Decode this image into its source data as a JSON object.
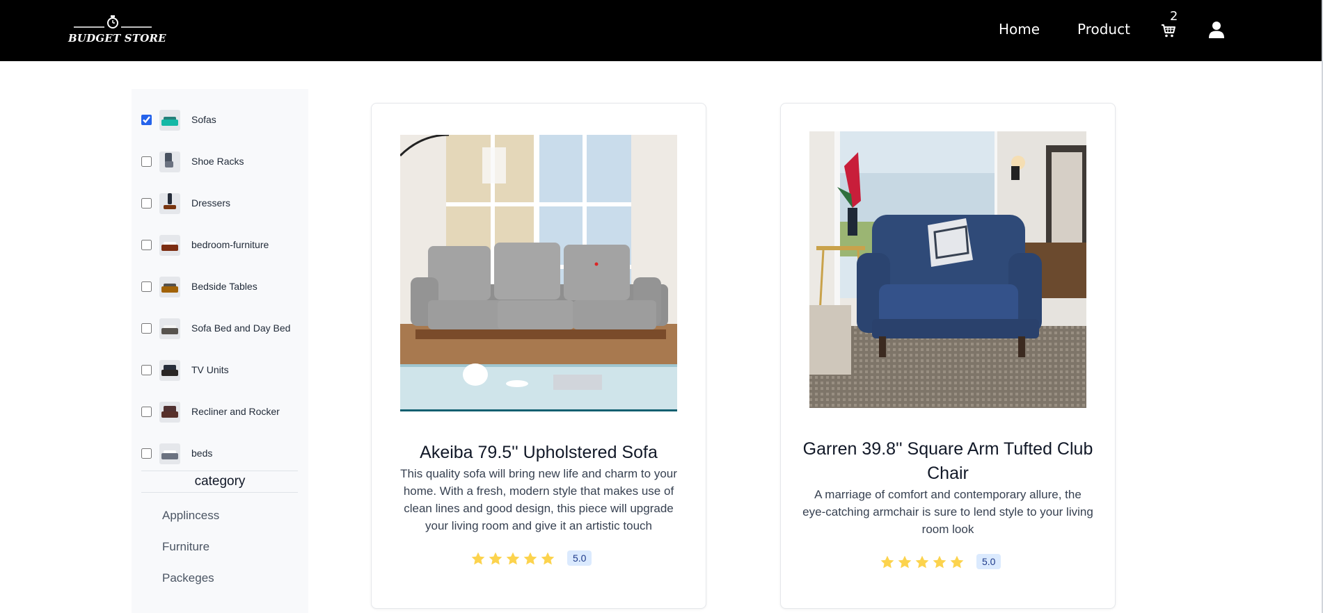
{
  "brand": {
    "name": "BUDGET STORE"
  },
  "nav": {
    "links": [
      {
        "label": "Home"
      },
      {
        "label": "Product"
      }
    ],
    "cart": {
      "count": "2",
      "icon": "shopping-cart-icon"
    },
    "user": {
      "icon": "user-icon"
    }
  },
  "sidebar": {
    "filters": [
      {
        "label": "Sofas",
        "checked": true
      },
      {
        "label": "Shoe Racks",
        "checked": false
      },
      {
        "label": "Dressers",
        "checked": false
      },
      {
        "label": "bedroom-furniture",
        "checked": false
      },
      {
        "label": "Bedside Tables",
        "checked": false
      },
      {
        "label": "Sofa Bed and Day Bed",
        "checked": false
      },
      {
        "label": "TV Units",
        "checked": false
      },
      {
        "label": "Recliner and Rocker",
        "checked": false
      },
      {
        "label": "beds",
        "checked": false
      }
    ],
    "category_title": "category",
    "categories": [
      {
        "label": "Applincess"
      },
      {
        "label": "Furniture"
      },
      {
        "label": "Packeges"
      }
    ]
  },
  "products": [
    {
      "title": "Akeiba 79.5'' Upholstered Sofa",
      "description": "This quality sofa will bring new life and charm to your home. With a fresh, modern style that makes use of clean lines and good design, this piece will upgrade your living room and give it an artistic touch",
      "rating": "5.0",
      "stars": 5
    },
    {
      "title": "Garren 39.8'' Square Arm Tufted Club Chair",
      "description": "A marriage of comfort and contemporary allure, the eye-catching armchair is sure to lend style to your living room look",
      "rating": "5.0",
      "stars": 5
    }
  ],
  "colors": {
    "navbar": "#000000",
    "sidebar_bg": "#f8f9fb",
    "star": "#fcd34d",
    "rating_badge_bg": "#dbeafe",
    "checkbox_accent": "#2563eb"
  }
}
